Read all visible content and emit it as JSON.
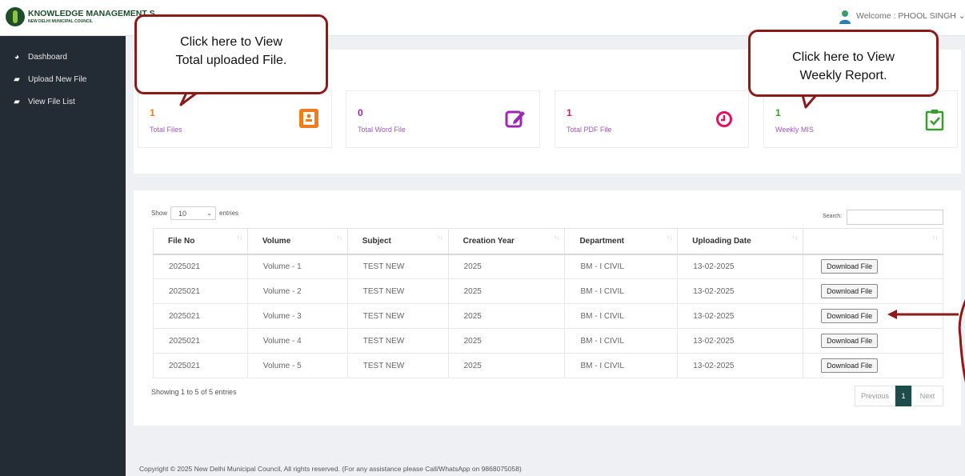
{
  "header": {
    "app_title": "KNOWLEDGE MANAGEMENT S",
    "app_subtitle": "NEW DELHI MUNICIPAL COUNCIL",
    "welcome": "Welcome : PHOOL SINGH"
  },
  "sidebar": {
    "items": [
      {
        "label": "Dashboard",
        "icon": "dashboard-icon"
      },
      {
        "label": "Upload New File",
        "icon": "book-icon"
      },
      {
        "label": "View File List",
        "icon": "book-icon"
      }
    ]
  },
  "stats": [
    {
      "value": "1",
      "label": "Total Files",
      "color": "#f07c1b",
      "icon": "contact-card-icon"
    },
    {
      "value": "0",
      "label": "Total Word File",
      "color": "#9b27b0",
      "icon": "edit-icon"
    },
    {
      "value": "1",
      "label": "Total PDF File",
      "color": "#e0115f",
      "icon": "clock-icon"
    },
    {
      "value": "1",
      "label": "Weekly MIS",
      "color": "#3a9b2f",
      "icon": "clipboard-check-icon"
    }
  ],
  "table": {
    "show_label": "Show",
    "entries_value": "10",
    "entries_label": "entries",
    "search_label": "Search:",
    "columns": [
      "File No",
      "Volume",
      "Subject",
      "Creation Year",
      "Department",
      "Uploading Date",
      ""
    ],
    "rows": [
      {
        "file_no": "2025021",
        "volume": "Volume - 1",
        "subject": "TEST NEW",
        "year": "2025",
        "department": "BM - I CIVIL",
        "date": "13-02-2025",
        "action": "Download File"
      },
      {
        "file_no": "2025021",
        "volume": "Volume - 2",
        "subject": "TEST NEW",
        "year": "2025",
        "department": "BM - I CIVIL",
        "date": "13-02-2025",
        "action": "Download File"
      },
      {
        "file_no": "2025021",
        "volume": "Volume - 3",
        "subject": "TEST NEW",
        "year": "2025",
        "department": "BM - I CIVIL",
        "date": "13-02-2025",
        "action": "Download File"
      },
      {
        "file_no": "2025021",
        "volume": "Volume - 4",
        "subject": "TEST NEW",
        "year": "2025",
        "department": "BM - I CIVIL",
        "date": "13-02-2025",
        "action": "Download File"
      },
      {
        "file_no": "2025021",
        "volume": "Volume - 5",
        "subject": "TEST NEW",
        "year": "2025",
        "department": "BM - I CIVIL",
        "date": "13-02-2025",
        "action": "Download File"
      }
    ],
    "showing": "Showing 1 to 5 of 5 entries",
    "pagination": {
      "previous": "Previous",
      "current": "1",
      "next": "Next"
    }
  },
  "footer": "Copyright © 2025 New Delhi Municipal Council, All rights reserved. (For any assistance please Call/WhatsApp on 9868075058)",
  "callouts": {
    "total_files": [
      "Click here to View",
      "Total uploaded File."
    ],
    "weekly": [
      "Click here to View",
      "Weekly Report."
    ]
  },
  "colors": {
    "sidebar": "#232b34",
    "annotation": "#8b1a1a",
    "accent": "#1d4d4a"
  }
}
